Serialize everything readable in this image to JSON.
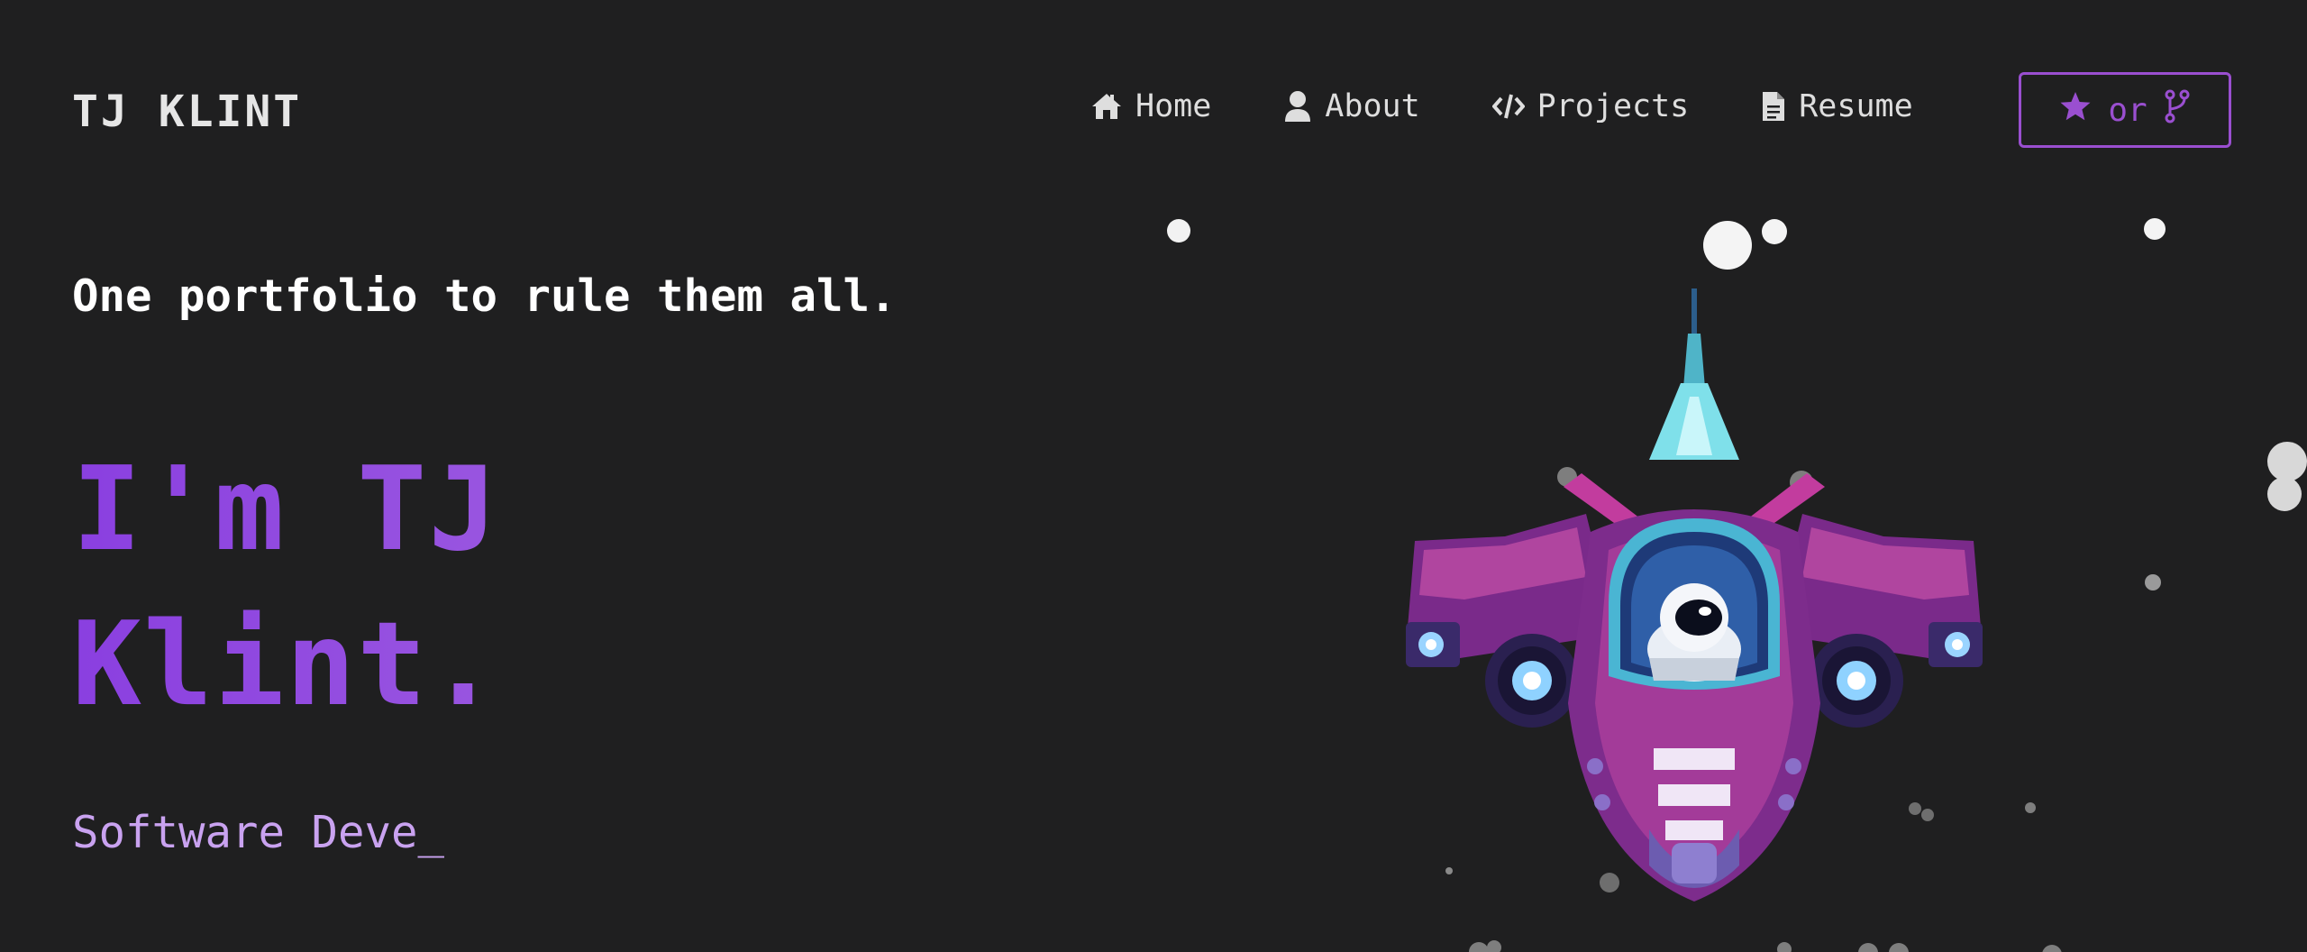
{
  "header": {
    "brand": "TJ KLINT",
    "nav": [
      {
        "label": "Home",
        "icon": "home-icon"
      },
      {
        "label": "About",
        "icon": "user-icon"
      },
      {
        "label": "Projects",
        "icon": "code-icon"
      },
      {
        "label": "Resume",
        "icon": "document-icon"
      }
    ],
    "github_button": {
      "star_icon": "star-icon",
      "separator": "or",
      "fork_icon": "fork-icon"
    }
  },
  "hero": {
    "tagline": "One portfolio to rule them all.",
    "title_line1": "I'm TJ",
    "title_line2": "Klint.",
    "typed_role": "Software Deve_"
  },
  "colors": {
    "background": "#1f1f20",
    "accent": "#9a4fd0",
    "title_gradient_start": "#8a3fe0",
    "title_gradient_end": "#a060e0",
    "role_text": "#c9a2f0"
  }
}
